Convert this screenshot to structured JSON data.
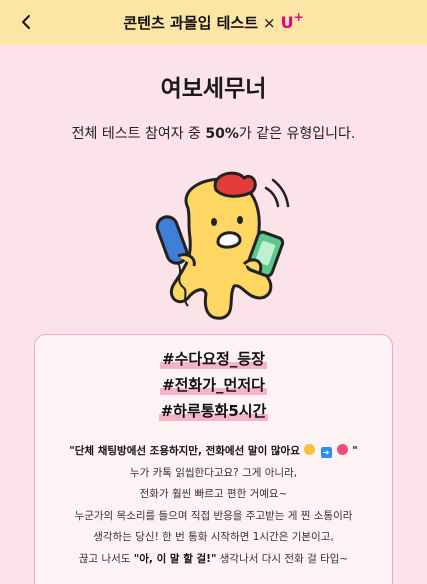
{
  "header": {
    "title": "콘텐츠 과몰입 테스트",
    "separator": "×",
    "brand_text": "U",
    "brand_plus": "+"
  },
  "result": {
    "title": "여보세무너",
    "subtitle_prefix": "전체 테스트 참여자 중 ",
    "subtitle_percent": "50%",
    "subtitle_suffix": "가 같은 유형입니다."
  },
  "tags": [
    "#수다요정_등장",
    "#전화가_먼저다",
    "#하루통화5시간"
  ],
  "description": {
    "quote_text": "\"단체 채팅방에선 조용하지만, 전화에선 말이 많아요",
    "quote_end": "\"",
    "line2": "누가 카톡 읽씹한다고요? 그게 아니라,",
    "line3": "전화가 훨씬 빠르고 편한 거예요~",
    "line4": "누군가의 목소리를 들으며 직접 반응을 주고받는 게 찐 소통이라",
    "line5": "생각하는 당신! 한 번 통화 시작하면 1시간은 기본이고,",
    "line6_prefix": "끊고 나서도 ",
    "line6_bold": "\"아, 이 말 할 걸!\"",
    "line6_suffix": " 생각나서 다시 전화 걸 타입~"
  },
  "icons": {
    "back": "chevron-left-icon",
    "emoji1": "grimace-emoji",
    "emoji2": "right-arrow-emoji",
    "emoji3": "grinning-emoji"
  },
  "colors": {
    "header_bg": "#fde5a6",
    "page_bg": "#fbe3e9",
    "brand": "#e6007e",
    "tag_highlight": "#f6b3c6",
    "character_body": "#fdd663",
    "phone_blue": "#3f7fd6",
    "hair_red": "#e63b3b"
  }
}
